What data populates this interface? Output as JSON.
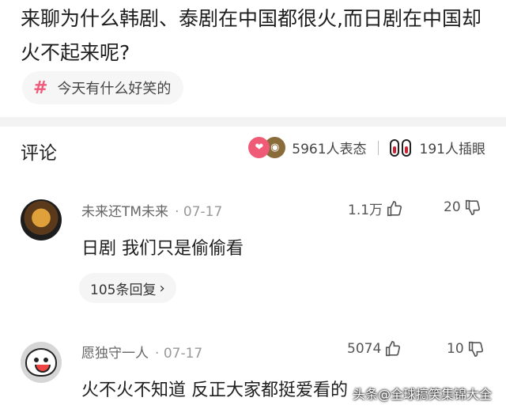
{
  "question": {
    "text": "来聊为什么韩剧、泰剧在中国都很火,而日剧在中国却火不起来呢?"
  },
  "topic": {
    "label": "今天有什么好笑的"
  },
  "comments_header": {
    "title": "评论",
    "reaction_count": "5961人表态",
    "insert_count": "191人插眼"
  },
  "comments": [
    {
      "username": "未来还TM未来",
      "date": "07-17",
      "likes": "1.1万",
      "dislikes": "20",
      "text": "日剧 我们只是偷偷看",
      "replies": "105条回复"
    },
    {
      "username": "愿独守一人",
      "date": "07-17",
      "likes": "5074",
      "dislikes": "10",
      "text": "火不火不知道 反正大家都挺爱看的"
    }
  ],
  "watermark": "头条@全球搞笑集锦大全",
  "colors": {
    "accent": "#ef5b76",
    "background": "#ffffff",
    "divider": "#f3f3f3"
  }
}
